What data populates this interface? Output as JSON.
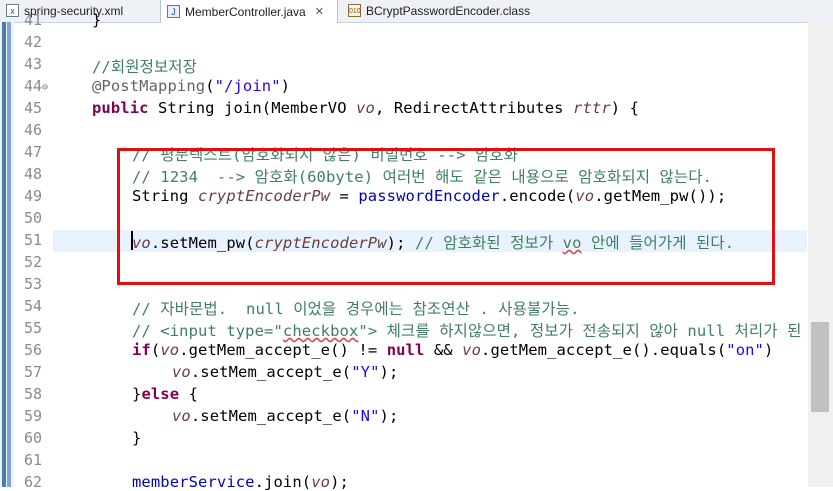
{
  "tabs": [
    {
      "label": "spring-security.xml",
      "icon": "xml-file-icon"
    },
    {
      "label": "MemberController.java",
      "icon": "java-file-icon",
      "active": true
    },
    {
      "label": "BCryptPasswordEncoder.class",
      "icon": "class-file-icon"
    }
  ],
  "lines": [
    {
      "n": "41",
      "t": "}"
    },
    {
      "n": "42",
      "t": ""
    },
    {
      "n": "43",
      "t": "//회원정보저장"
    },
    {
      "n": "44",
      "t": "@PostMapping(\"/join\")"
    },
    {
      "n": "45",
      "t": "public String join(MemberVO vo, RedirectAttributes rttr) {"
    },
    {
      "n": "46",
      "t": ""
    },
    {
      "n": "47",
      "t": "// 평문텍스트(암호화되지 않은) 비밀번호 --> 암호화"
    },
    {
      "n": "48",
      "t": "// 1234  --> 암호화(60byte) 여러번 해도 같은 내용으로 암호화되지 않는다."
    },
    {
      "n": "49",
      "t": "String cryptEncoderPw = passwordEncoder.encode(vo.getMem_pw());"
    },
    {
      "n": "50",
      "t": ""
    },
    {
      "n": "51",
      "t": "vo.setMem_pw(cryptEncoderPw); // 암호화된 정보가 vo 안에 들어가게 된다."
    },
    {
      "n": "52",
      "t": ""
    },
    {
      "n": "53",
      "t": ""
    },
    {
      "n": "54",
      "t": "// 자바문법.  null 이었을 경우에는 참조연산 . 사용불가능."
    },
    {
      "n": "55",
      "t": "// <input type=\"checkbox\"> 체크를 하지않으면, 정보가 전송되지 않아 null 처리가 된"
    },
    {
      "n": "56",
      "t": "if(vo.getMem_accept_e() != null && vo.getMem_accept_e().equals(\"on\")"
    },
    {
      "n": "57",
      "t": "vo.setMem_accept_e(\"Y\");"
    },
    {
      "n": "58",
      "t": "}else {"
    },
    {
      "n": "59",
      "t": "vo.setMem_accept_e(\"N\");"
    },
    {
      "n": "60",
      "t": "}"
    },
    {
      "n": "61",
      "t": ""
    },
    {
      "n": "62",
      "t": "memberService.join(vo);"
    }
  ]
}
